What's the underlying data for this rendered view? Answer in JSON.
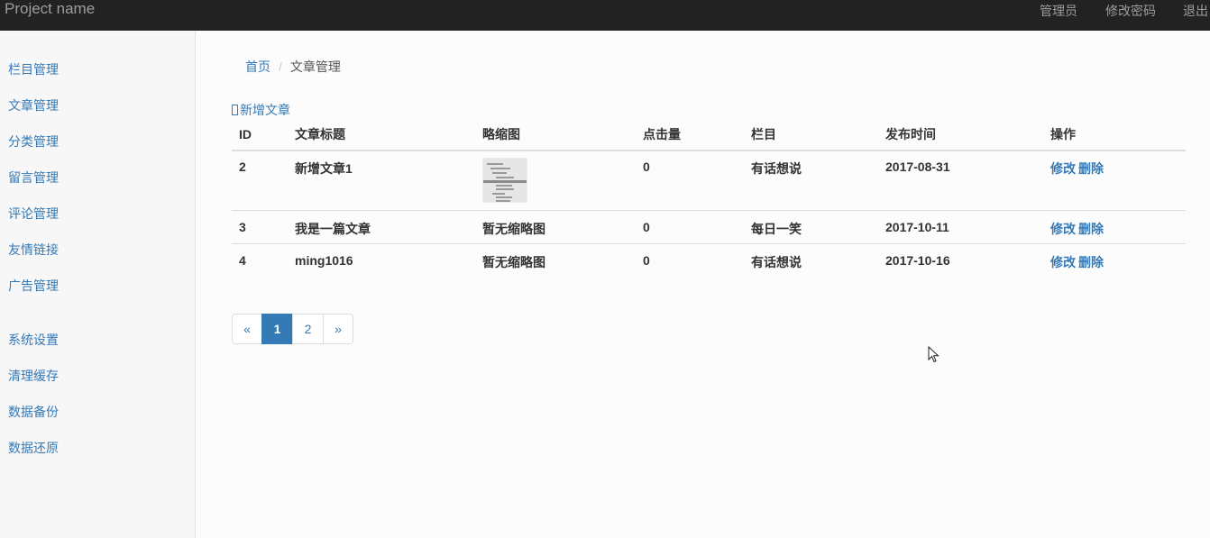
{
  "topbar": {
    "brand": "Project name",
    "links": [
      "管理员",
      "修改密码",
      "退出"
    ]
  },
  "sidebar": {
    "items": [
      "栏目管理",
      "文章管理",
      "分类管理",
      "留言管理",
      "评论管理",
      "友情链接",
      "广告管理",
      "系统设置",
      "清理缓存",
      "数据备份",
      "数据还原"
    ]
  },
  "breadcrumb": {
    "home": "首页",
    "separator": "/",
    "current": "文章管理"
  },
  "add_article_label": "新增文章",
  "table": {
    "headers": [
      "ID",
      "文章标题",
      "略缩图",
      "点击量",
      "栏目",
      "发布时间",
      "操作"
    ],
    "rows": [
      {
        "id": "2",
        "title": "新增文章1",
        "thumb": "",
        "clicks": "0",
        "column": "有话想说",
        "date": "2017-08-31",
        "edit": "修改",
        "delete": "删除"
      },
      {
        "id": "3",
        "title": "我是一篇文章",
        "thumb": "暂无缩略图",
        "clicks": "0",
        "column": "每日一笑",
        "date": "2017-10-11",
        "edit": "修改",
        "delete": "删除"
      },
      {
        "id": "4",
        "title": "ming1016",
        "thumb": "暂无缩略图",
        "clicks": "0",
        "column": "有话想说",
        "date": "2017-10-16",
        "edit": "修改",
        "delete": "删除"
      }
    ]
  },
  "pagination": {
    "prev": "«",
    "pages": [
      "1",
      "2"
    ],
    "next": "»",
    "current": "1"
  },
  "colors": {
    "topbar": "#222222",
    "link": "#337ab7",
    "active_page": "#337ab7"
  }
}
